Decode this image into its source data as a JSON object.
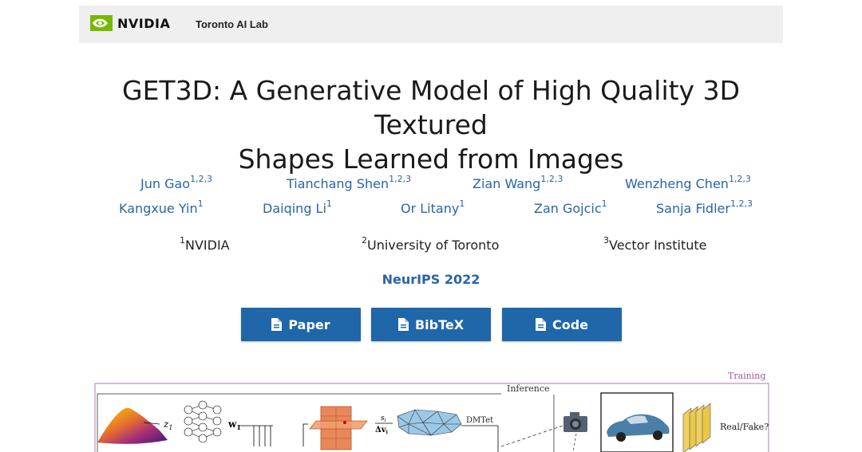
{
  "header": {
    "brand": "NVIDIA",
    "lab_link": "Toronto AI Lab"
  },
  "title": {
    "line1": "GET3D: A Generative Model of High Quality 3D Textured",
    "line2": "Shapes Learned from Images"
  },
  "authors": [
    {
      "name": "Jun Gao",
      "affil": "1,2,3"
    },
    {
      "name": "Tianchang Shen",
      "affil": "1,2,3"
    },
    {
      "name": "Zian Wang",
      "affil": "1,2,3"
    },
    {
      "name": "Wenzheng Chen",
      "affil": "1,2,3"
    },
    {
      "name": "Kangxue Yin",
      "affil": "1"
    },
    {
      "name": "Daiqing Li",
      "affil": "1"
    },
    {
      "name": "Or Litany",
      "affil": "1"
    },
    {
      "name": "Zan Gojcic",
      "affil": "1"
    },
    {
      "name": "Sanja Fidler",
      "affil": "1,2,3"
    }
  ],
  "affiliations": [
    {
      "num": "1",
      "name": "NVIDIA"
    },
    {
      "num": "2",
      "name": "University of Toronto"
    },
    {
      "num": "3",
      "name": "Vector Institute"
    }
  ],
  "venue": "NeurIPS 2022",
  "buttons": [
    {
      "label": "Paper",
      "icon": "document-icon"
    },
    {
      "label": "BibTeX",
      "icon": "document-icon"
    },
    {
      "label": "Code",
      "icon": "document-icon"
    }
  ],
  "figure": {
    "training_label": "Training",
    "inference_label": "Inference",
    "z_label": "z",
    "z_sub": "1",
    "w_label": "w",
    "w_sub": "1",
    "s_label": "s",
    "s_sub": "i",
    "dv_label": "Δv",
    "dv_sub": "i",
    "dmtet_label": "DMTet",
    "realfake_label": "Real/Fake?"
  },
  "colors": {
    "link": "#2a64a6",
    "button": "#1f67a8",
    "topbar": "#efefef",
    "nvidia_green": "#76b900",
    "training_frame": "#b07ab0"
  }
}
